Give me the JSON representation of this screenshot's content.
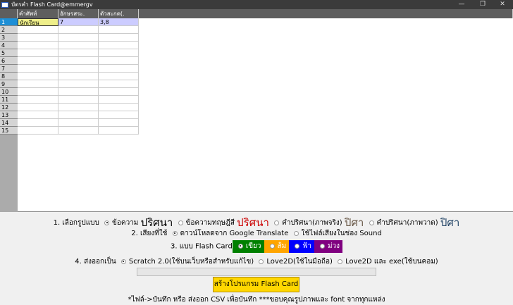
{
  "window": {
    "title": "บัตรคำ Flash Card@emmergv",
    "minimize": "—",
    "maximize": "❐",
    "close": "✕"
  },
  "grid": {
    "columns": [
      "คำศัพท์",
      "อักษรสระ.",
      "ตัวสะกด(."
    ],
    "rows": [
      [
        "นักเรียน",
        "7",
        "3,8"
      ]
    ],
    "row_numbers": [
      "1",
      "2",
      "3",
      "4",
      "5",
      "6",
      "7",
      "8",
      "9",
      "10",
      "11",
      "12",
      "13",
      "14",
      "15"
    ]
  },
  "options": {
    "format": {
      "label": "1. เลือกรูปแบบ",
      "choices": [
        "ข้อความ",
        "ข้อความทฤษฎีสี",
        "คำปริศนา(ภาพจริง)",
        "คำปริศนา(ภาพวาด)"
      ],
      "sample": "ปริศนา",
      "selected": 0
    },
    "sound": {
      "label": "2. เสียงที่ใช้",
      "choices": [
        "ดาวน์โหลดจาก Google Translate",
        "ใช้ไฟล์เสียงในช่อง Sound"
      ],
      "selected": 0
    },
    "card": {
      "label": "3. แบบ Flash Card",
      "choices": [
        {
          "name": "เขียว",
          "color": "#008000"
        },
        {
          "name": "ส้ม",
          "color": "#ffa500"
        },
        {
          "name": "ฟ้า",
          "color": "#0000ff"
        },
        {
          "name": "ม่วง",
          "color": "#800080"
        }
      ],
      "selected": 0
    },
    "export": {
      "label": "4. ส่งออกเป็น",
      "choices": [
        "Scratch 2.0(ใช้บนเว็บหรือสำหรับแก้ไข)",
        "Love2D(ใช้ในมือถือ)",
        "Love2D และ exe(ใช้บนคอม)"
      ],
      "selected": 0
    }
  },
  "progress": 0,
  "generate_button": "สร้างโปรแกรม Flash Card",
  "footer": "*ไฟล์->บันทึก หรือ ส่งออก CSV เพื่อบันทึก ***ขอบคุณรูปภาพและ font จากทุกแหล่ง"
}
